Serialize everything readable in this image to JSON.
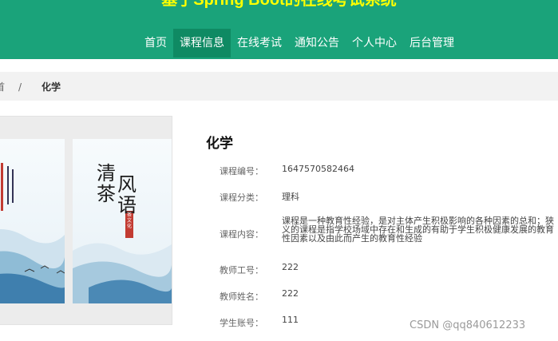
{
  "header": {
    "title": "基于Spring Boot的在线考试系统",
    "nav": [
      "首页",
      "课程信息",
      "在线考试",
      "通知公告",
      "个人中心",
      "后台管理"
    ],
    "active_index": 1
  },
  "breadcrumb": {
    "home": "首",
    "separator": "/",
    "current": "化学"
  },
  "cover": {
    "title_chars": [
      "清",
      "风",
      "茶",
      "语"
    ],
    "seal": "茶文化"
  },
  "course": {
    "name": "化学",
    "fields": [
      {
        "label": "课程编号：",
        "value": "1647570582464"
      },
      {
        "label": "课程分类：",
        "value": "理科"
      },
      {
        "label": "课程内容：",
        "value": "课程是一种教育性经验，是对主体产生积极影响的各种因素的总和；狭义的课程是指学校场域中存在和生成的有助于学生积极健康发展的教育性因素以及由此而产生的教育性经验"
      },
      {
        "label": "教师工号：",
        "value": "222"
      },
      {
        "label": "教师姓名：",
        "value": "222"
      },
      {
        "label": "学生账号：",
        "value": "111"
      }
    ]
  },
  "watermark": "CSDN @qq840612233",
  "colors": {
    "header_bg": "#1aa37a",
    "nav_active_bg": "#0f8a63",
    "title_color": "#ffff00"
  }
}
